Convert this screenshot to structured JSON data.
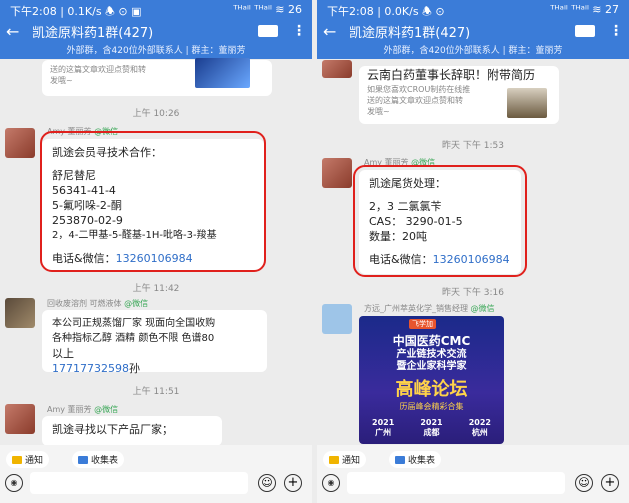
{
  "left": {
    "status": {
      "time": "下午2:08 | 0.1K/s 🕭 ⊙ ▣",
      "right": "ᵀᴴᵃⁱˡ ᵀᴴᵃⁱˡ ≋ 26"
    },
    "title": "凯途原料药1群(427)",
    "subbar": "外部群，含420位外部联系人 | 群主：董丽芳",
    "top_card_text": "送的这篇文章欢迎点赞和转\n发哦~",
    "times": [
      "上午 10:26",
      "上午 11:42",
      "上午 11:51"
    ],
    "msg1": {
      "sender": "Amy 董丽芳",
      "tag": "@微信",
      "lines": [
        "凯途会员寻技术合作：",
        "",
        "舒尼替尼",
        "56341-41-4",
        "5-氟吲哚-2-酮",
        "253870-02-9",
        "2，4-二甲基-5-醛基-1H-吡咯-3-羧基",
        "",
        "电话&微信："
      ],
      "phone": "13260106984"
    },
    "msg2": {
      "sender": "回收废溶剂 可燃液体",
      "tag": "@微信",
      "lines": [
        "本公司正规蒸馏厂家 现面向全国收购",
        "各种指标乙醇 酒精 颜色不限 色谱80",
        "以上"
      ],
      "phone": "17717732598",
      "suffix": "孙"
    },
    "msg3": {
      "sender": "Amy 董丽芳",
      "tag": "@微信",
      "text": "凯途寻找以下产品厂家；"
    }
  },
  "right": {
    "status": {
      "time": "下午2:08 | 0.0K/s 🕭 ⊙",
      "right": "ᵀᴴᵃⁱˡ ᵀᴴᵃⁱˡ ≋ 27"
    },
    "title": "凯途原料药1群(427)",
    "subbar": "外部群，含420位外部联系人 | 群主：董丽芳",
    "card": {
      "title": "云南白药董事长辞职！附带简历",
      "text": "如果您喜欢CROU制药在线推\n送的这篇文章欢迎点赞和转\n发哦~"
    },
    "times": [
      "昨天 下午 1:53",
      "昨天 下午 3:16"
    ],
    "msg1": {
      "sender": "Amy 董丽芳",
      "tag": "@微信",
      "lines": [
        "凯途尾货处理：",
        "",
        "2，3 二氯氯苄",
        "CAS：  3290-01-5",
        "数量：20吨",
        "",
        "电话&微信："
      ],
      "phone": "13260106984"
    },
    "msg2": {
      "sender": "方远_广州萃英化学_销售经理",
      "tag": "@微信"
    },
    "poster": {
      "logo": "飞学加",
      "line1": "中国医药CMC",
      "line2": "产业链技术交流",
      "line3": "暨企业家科学家",
      "big": "高峰论坛",
      "sub": "历届峰会精彩合集",
      "years": [
        "2021",
        "2021",
        "2022"
      ],
      "cities": [
        "广州",
        "成都",
        "杭州"
      ]
    }
  },
  "bottom": {
    "notice": "通知",
    "collect": "收集表"
  },
  "colors": {
    "accent": "#3b7cd8",
    "highlight": "#e0201c",
    "phone": "#2f6ec8",
    "tag": "#3aa757"
  }
}
